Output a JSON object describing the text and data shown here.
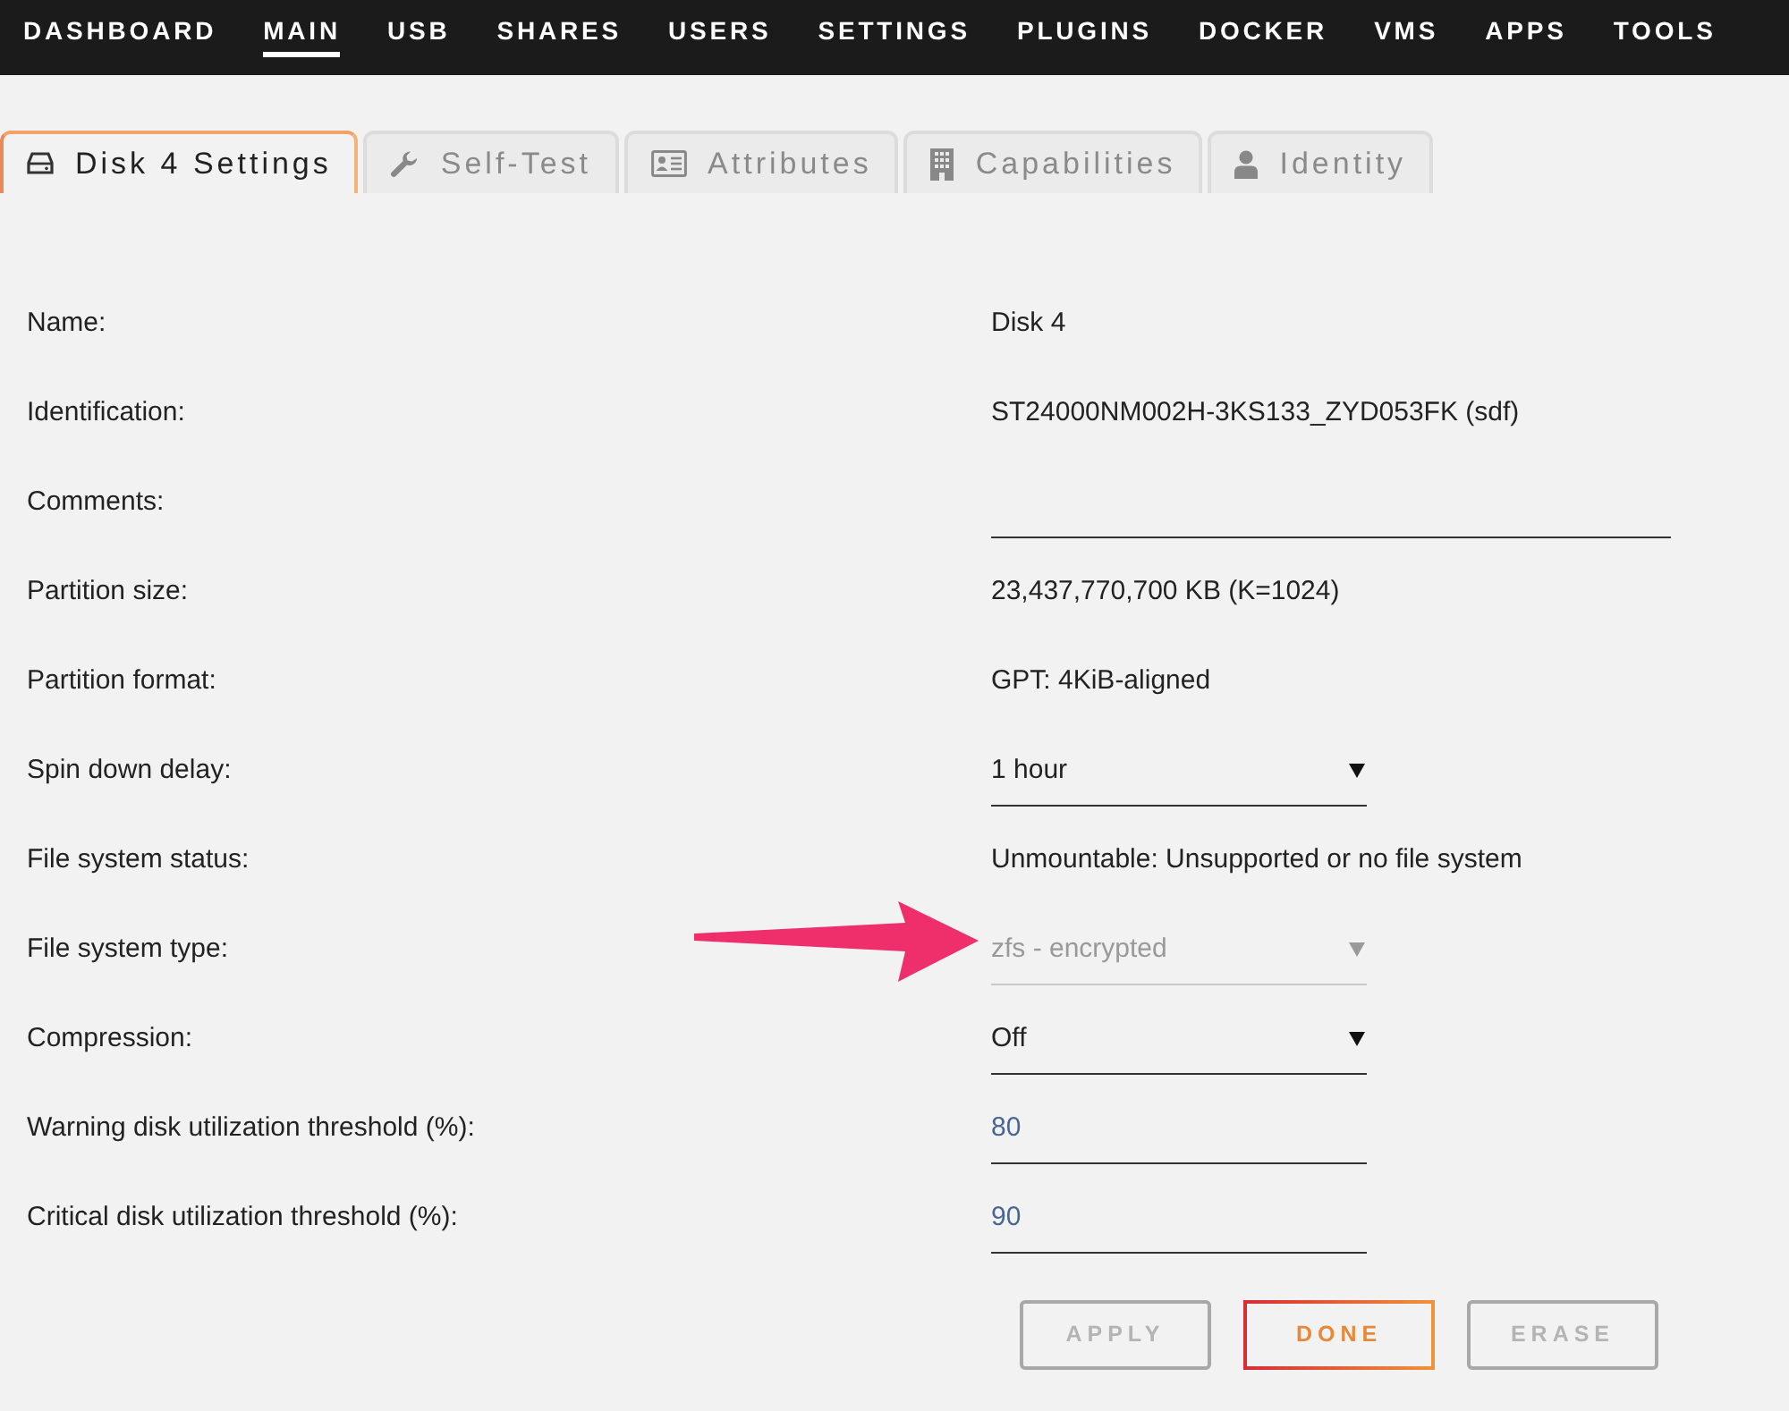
{
  "nav": {
    "items": [
      {
        "label": "DASHBOARD",
        "selected": false
      },
      {
        "label": "MAIN",
        "selected": true
      },
      {
        "label": "USB",
        "selected": false
      },
      {
        "label": "SHARES",
        "selected": false
      },
      {
        "label": "USERS",
        "selected": false
      },
      {
        "label": "SETTINGS",
        "selected": false
      },
      {
        "label": "PLUGINS",
        "selected": false
      },
      {
        "label": "DOCKER",
        "selected": false
      },
      {
        "label": "VMS",
        "selected": false
      },
      {
        "label": "APPS",
        "selected": false
      },
      {
        "label": "TOOLS",
        "selected": false
      }
    ]
  },
  "tabs": [
    {
      "label": "Disk 4 Settings",
      "selected": true
    },
    {
      "label": "Self-Test",
      "selected": false
    },
    {
      "label": "Attributes",
      "selected": false
    },
    {
      "label": "Capabilities",
      "selected": false
    },
    {
      "label": "Identity",
      "selected": false
    }
  ],
  "form": {
    "rows": [
      {
        "label": "Name:",
        "kind": "text",
        "value": "Disk 4"
      },
      {
        "label": "Identification:",
        "kind": "text",
        "value": "ST24000NM002H-3KS133_ZYD053FK (sdf)"
      },
      {
        "label": "Comments:",
        "kind": "text_field"
      },
      {
        "label": "Partition size:",
        "kind": "text",
        "value": "23,437,770,700 KB (K=1024)"
      },
      {
        "label": "Partition format:",
        "kind": "text",
        "value": "GPT: 4KiB-aligned"
      },
      {
        "label": "Spin down delay:",
        "kind": "select",
        "value": "1 hour",
        "disabled": false
      },
      {
        "label": "File system status:",
        "kind": "text",
        "value": "Unmountable: Unsupported or no file system"
      },
      {
        "label": "File system type:",
        "kind": "select",
        "value": "zfs - encrypted",
        "disabled": true
      },
      {
        "label": "Compression:",
        "kind": "select",
        "value": "Off",
        "disabled": false
      },
      {
        "label": "Warning disk utilization threshold (%):",
        "kind": "number_field",
        "value": "80"
      },
      {
        "label": "Critical disk utilization threshold (%):",
        "kind": "number_field",
        "value": "90"
      }
    ]
  },
  "buttons": [
    {
      "label": "APPLY",
      "disabled": true
    },
    {
      "label": "DONE",
      "disabled": false
    },
    {
      "label": "ERASE",
      "disabled": true
    }
  ]
}
